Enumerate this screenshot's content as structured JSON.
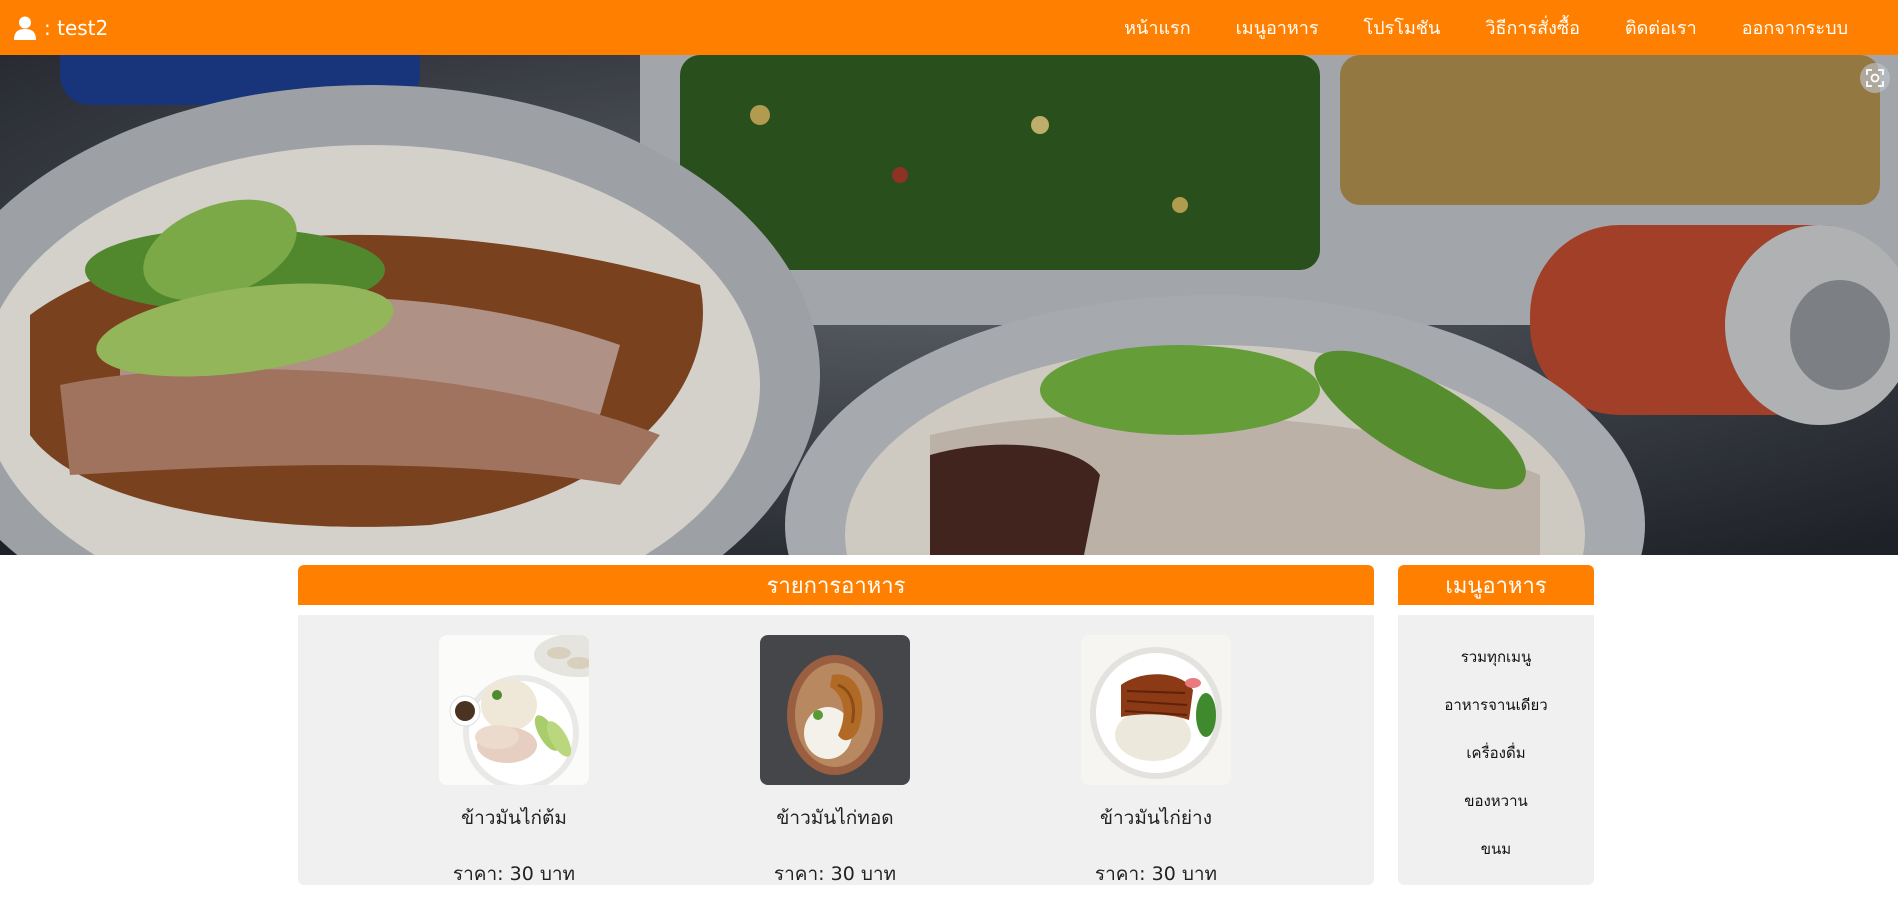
{
  "user": {
    "label": ": test2",
    "icon": "user-icon"
  },
  "nav": [
    {
      "label": "หน้าแรก"
    },
    {
      "label": "เมนูอาหาร"
    },
    {
      "label": "โปรโมชัน"
    },
    {
      "label": "วิธีการสั่งซื้อ"
    },
    {
      "label": "ติดต่อเรา"
    },
    {
      "label": "ออกจากระบบ"
    }
  ],
  "hero": {
    "image": "chicken-rice-banner",
    "action_icon": "visual-search-icon"
  },
  "food_list": {
    "title": "รายการอาหาร",
    "items": [
      {
        "name": "ข้าวมันไก่ต้ม",
        "price": "ราคา: 30 บาท",
        "image": "boiled-chicken-rice-photo"
      },
      {
        "name": "ข้าวมันไก่ทอด",
        "price": "ราคา: 30 บาท",
        "image": "fried-chicken-rice-photo"
      },
      {
        "name": "ข้าวมันไก่ย่าง",
        "price": "ราคา: 30 บาท",
        "image": "grilled-chicken-rice-photo"
      }
    ]
  },
  "category_menu": {
    "title": "เมนูอาหาร",
    "items": [
      {
        "label": "รวมทุกเมนู"
      },
      {
        "label": "อาหารจานเดียว"
      },
      {
        "label": "เครื่องดื่ม"
      },
      {
        "label": "ของหวาน"
      },
      {
        "label": "ขนม"
      }
    ]
  },
  "colors": {
    "brand": "#ff8000",
    "panel_bg": "#f0f0f0",
    "text": "#222222"
  }
}
